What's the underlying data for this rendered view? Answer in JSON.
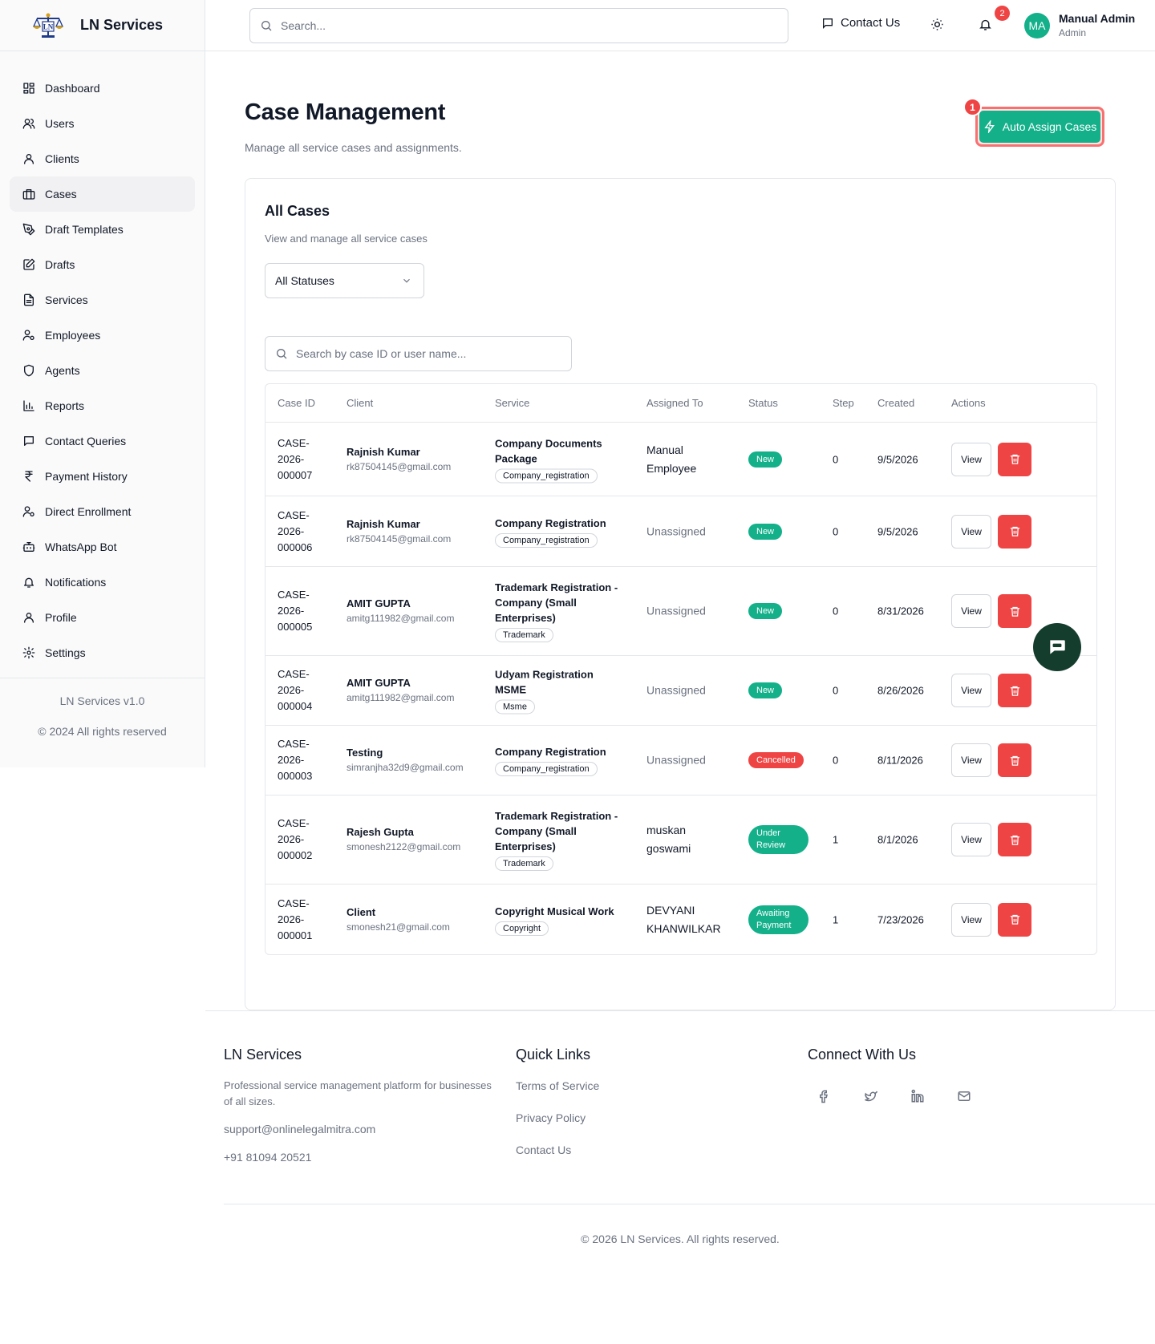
{
  "brand": {
    "name": "LN Services"
  },
  "sidebar": {
    "items": [
      {
        "label": "Dashboard",
        "icon": "dashboard-icon"
      },
      {
        "label": "Users",
        "icon": "users-icon"
      },
      {
        "label": "Clients",
        "icon": "user-icon"
      },
      {
        "label": "Cases",
        "icon": "briefcase-icon",
        "active": true
      },
      {
        "label": "Draft Templates",
        "icon": "pen-tool-icon"
      },
      {
        "label": "Drafts",
        "icon": "edit-icon"
      },
      {
        "label": "Services",
        "icon": "file-icon"
      },
      {
        "label": "Employees",
        "icon": "user-cog-icon"
      },
      {
        "label": "Agents",
        "icon": "shield-icon"
      },
      {
        "label": "Reports",
        "icon": "bar-chart-icon"
      },
      {
        "label": "Contact Queries",
        "icon": "message-icon"
      },
      {
        "label": "Payment History",
        "icon": "rupee-icon"
      },
      {
        "label": "Direct Enrollment",
        "icon": "user-cog-icon"
      },
      {
        "label": "WhatsApp Bot",
        "icon": "bot-icon"
      },
      {
        "label": "Notifications",
        "icon": "bell-icon"
      },
      {
        "label": "Profile",
        "icon": "user-icon"
      },
      {
        "label": "Settings",
        "icon": "gear-icon"
      }
    ],
    "version": "LN Services v1.0",
    "rights": "© 2024 All rights reserved"
  },
  "topbar": {
    "search_placeholder": "Search...",
    "contact_label": "Contact Us",
    "notification_count": "2",
    "avatar_initials": "MA",
    "user_name": "Manual Admin",
    "user_role": "Admin"
  },
  "page": {
    "title": "Case Management",
    "subtitle": "Manage all service cases and assignments.",
    "auto_assign_label": "Auto Assign Cases",
    "auto_assign_badge": "1"
  },
  "card": {
    "title": "All Cases",
    "subtitle": "View and manage all service cases",
    "status_filter": "All Statuses",
    "search_placeholder": "Search by case ID or user name..."
  },
  "table": {
    "headers": [
      "Case ID",
      "Client",
      "Service",
      "Assigned To",
      "Status",
      "Step",
      "Created",
      "Actions"
    ],
    "view_label": "View",
    "rows": [
      {
        "id": [
          "CASE-",
          "2026-",
          "000007"
        ],
        "client": "Rajnish Kumar",
        "email": "rk87504145@gmail.com",
        "service": [
          "Company Documents",
          "Package"
        ],
        "tag": "Company_registration",
        "assigned": [
          "Manual",
          "Employee"
        ],
        "assigned_muted": false,
        "status": [
          "New"
        ],
        "status_color": "#14b08a",
        "step": "0",
        "created": "9/5/2026"
      },
      {
        "id": [
          "CASE-",
          "2026-",
          "000006"
        ],
        "client": "Rajnish Kumar",
        "email": "rk87504145@gmail.com",
        "service": [
          "Company Registration"
        ],
        "tag": "Company_registration",
        "assigned": [
          "Unassigned"
        ],
        "assigned_muted": true,
        "status": [
          "New"
        ],
        "status_color": "#14b08a",
        "step": "0",
        "created": "9/5/2026"
      },
      {
        "id": [
          "CASE-",
          "2026-",
          "000005"
        ],
        "client": "AMIT GUPTA",
        "email": "amitg111982@gmail.com",
        "service": [
          "Trademark Registration -",
          "Company (Small",
          "Enterprises)"
        ],
        "tag": "Trademark",
        "assigned": [
          "Unassigned"
        ],
        "assigned_muted": true,
        "status": [
          "New"
        ],
        "status_color": "#14b08a",
        "step": "0",
        "created": "8/31/2026"
      },
      {
        "id": [
          "CASE-",
          "2026-",
          "000004"
        ],
        "client": "AMIT GUPTA",
        "email": "amitg111982@gmail.com",
        "service": [
          "Udyam Registration MSME"
        ],
        "tag": "Msme",
        "assigned": [
          "Unassigned"
        ],
        "assigned_muted": true,
        "status": [
          "New"
        ],
        "status_color": "#14b08a",
        "step": "0",
        "created": "8/26/2026"
      },
      {
        "id": [
          "CASE-",
          "2026-",
          "000003"
        ],
        "client": "Testing",
        "email": "simranjha32d9@gmail.com",
        "service": [
          "Company Registration"
        ],
        "tag": "Company_registration",
        "assigned": [
          "Unassigned"
        ],
        "assigned_muted": true,
        "status": [
          "Cancelled"
        ],
        "status_color": "#ef4444",
        "step": "0",
        "created": "8/11/2026"
      },
      {
        "id": [
          "CASE-",
          "2026-",
          "000002"
        ],
        "client": "Rajesh Gupta",
        "email": "smonesh2122@gmail.com",
        "service": [
          "Trademark Registration -",
          "Company (Small",
          "Enterprises)"
        ],
        "tag": "Trademark",
        "assigned": [
          "muskan",
          "goswami"
        ],
        "assigned_muted": false,
        "status": [
          "Under",
          "Review"
        ],
        "status_color": "#14b08a",
        "step": "1",
        "created": "8/1/2026"
      },
      {
        "id": [
          "CASE-",
          "2026-",
          "000001"
        ],
        "client": "Client",
        "email": "smonesh21@gmail.com",
        "service": [
          "Copyright Musical Work"
        ],
        "tag": "Copyright",
        "assigned": [
          "DEVYANI",
          "KHANWILKAR"
        ],
        "assigned_muted": false,
        "status": [
          "Awaiting",
          "Payment"
        ],
        "status_color": "#14b08a",
        "step": "1",
        "created": "7/23/2026"
      }
    ]
  },
  "footer": {
    "brand": "LN Services",
    "description": "Professional service management platform for businesses of all sizes.",
    "email": "support@onlinelegalmitra.com",
    "phone": "+91 81094 20521",
    "quick_links_title": "Quick Links",
    "links": [
      "Terms of Service",
      "Privacy Policy",
      "Contact Us"
    ],
    "connect_title": "Connect With Us",
    "social": [
      "facebook-icon",
      "twitter-icon",
      "linkedin-icon",
      "mail-icon"
    ],
    "copyright": "© 2026 LN Services. All rights reserved."
  },
  "colors": {
    "accent": "#14b08a",
    "danger": "#ef4444",
    "chat": "#143d2e"
  }
}
